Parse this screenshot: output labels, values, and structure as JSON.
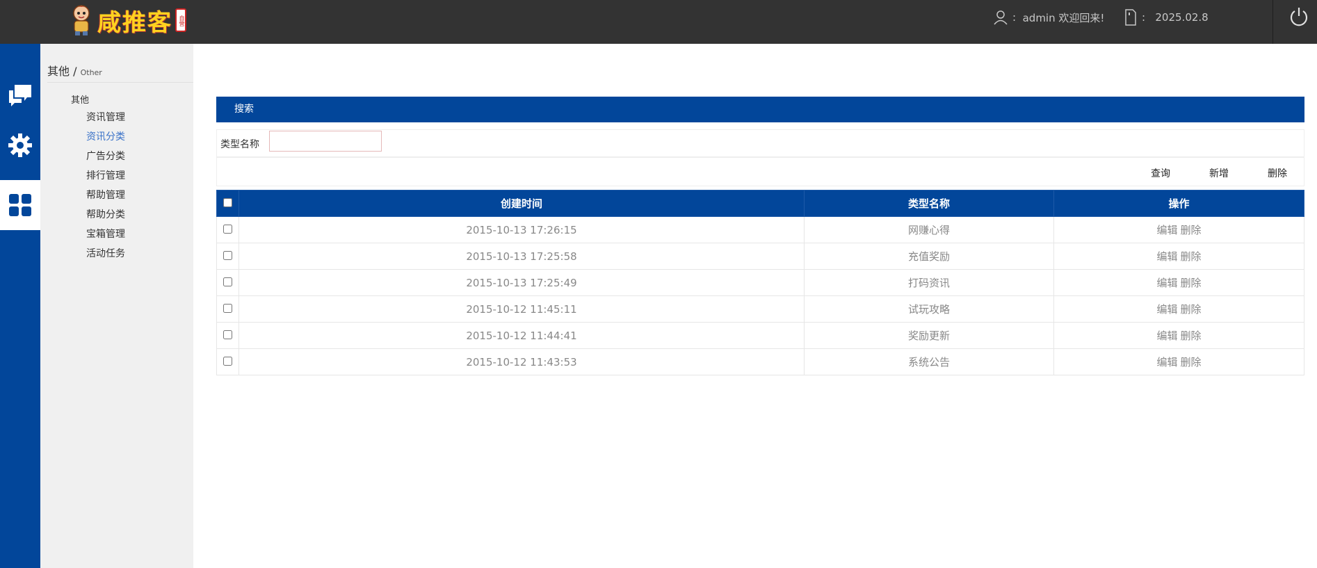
{
  "header": {
    "logo_text": "咸推客",
    "seal_text": "自营",
    "user_text": "admin 欢迎回来!",
    "user_prefix": ":",
    "date_prefix": ":",
    "date": "2025.02.8",
    "icons": {
      "user": "user-icon",
      "date": "phone-icon",
      "power": "power-icon"
    }
  },
  "rail": {
    "icons": [
      "chat-icon",
      "gear-icon",
      "grid-icon"
    ],
    "active_index": 2
  },
  "sidebar": {
    "breadcrumb_main": "其他",
    "breadcrumb_sep": "/",
    "breadcrumb_sub": "Other",
    "group_label": "其他",
    "items": [
      {
        "label": "资讯管理"
      },
      {
        "label": "资讯分类",
        "active": true
      },
      {
        "label": "广告分类"
      },
      {
        "label": "排行管理"
      },
      {
        "label": "帮助管理"
      },
      {
        "label": "帮助分类"
      },
      {
        "label": "宝箱管理"
      },
      {
        "label": "活动任务"
      }
    ]
  },
  "search": {
    "panel_title": "搜索",
    "field_label": "类型名称",
    "field_value": "",
    "field_placeholder": ""
  },
  "actions": {
    "query": "查询",
    "add": "新增",
    "delete": "删除"
  },
  "table": {
    "headers": {
      "time": "创建时间",
      "name": "类型名称",
      "ops": "操作"
    },
    "op_edit": "编辑",
    "op_delete": "删除",
    "rows": [
      {
        "time": "2015-10-13 17:26:15",
        "name": "网赚心得"
      },
      {
        "time": "2015-10-13 17:25:58",
        "name": "充值奖励"
      },
      {
        "time": "2015-10-13 17:25:49",
        "name": "打码资讯"
      },
      {
        "time": "2015-10-12 11:45:11",
        "name": "试玩攻略"
      },
      {
        "time": "2015-10-12 11:44:41",
        "name": "奖励更新"
      },
      {
        "time": "2015-10-12 11:43:53",
        "name": "系统公告"
      }
    ]
  },
  "colors": {
    "primary": "#02469a",
    "topbar": "#333333",
    "sidebar": "#f0f0f0",
    "active_link": "#3a72c8"
  }
}
